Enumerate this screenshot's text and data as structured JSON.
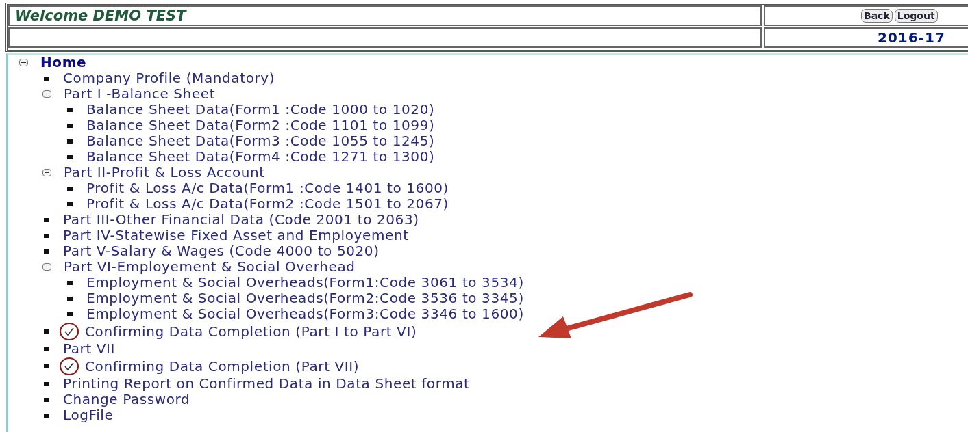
{
  "header": {
    "welcome": "Welcome DEMO TEST",
    "buttons": [
      "Back",
      "Logout"
    ],
    "year": "2016-17"
  },
  "tree": {
    "label": "Home",
    "expanded": true,
    "children": [
      {
        "label": "Company Profile (Mandatory)"
      },
      {
        "label": "Part I -Balance Sheet",
        "expanded": true,
        "children": [
          {
            "label": "Balance Sheet Data(Form1 :Code 1000 to 1020)"
          },
          {
            "label": "Balance Sheet Data(Form2 :Code 1101 to 1099)"
          },
          {
            "label": "Balance Sheet Data(Form3 :Code 1055 to 1245)"
          },
          {
            "label": "Balance Sheet Data(Form4 :Code 1271 to 1300)"
          }
        ]
      },
      {
        "label": "Part II-Profit & Loss Account",
        "expanded": true,
        "children": [
          {
            "label": "Profit & Loss A/c Data(Form1 :Code 1401 to 1600)"
          },
          {
            "label": "Profit & Loss A/c Data(Form2 :Code 1501 to 2067)"
          }
        ]
      },
      {
        "label": "Part III-Other Financial Data (Code 2001 to 2063)"
      },
      {
        "label": "Part IV-Statewise Fixed Asset and Employement"
      },
      {
        "label": "Part V-Salary & Wages (Code 4000 to 5020)"
      },
      {
        "label": "Part VI-Employement & Social Overhead",
        "expanded": true,
        "children": [
          {
            "label": "Employment & Social Overheads(Form1:Code 3061 to 3534)"
          },
          {
            "label": "Employment & Social Overheads(Form2:Code 3536 to 3345)"
          },
          {
            "label": "Employment & Social Overheads(Form3:Code 3346 to 1600)"
          }
        ]
      },
      {
        "label": "Confirming Data Completion (Part I to Part VI)",
        "kind": "confirm"
      },
      {
        "label": "Part VII"
      },
      {
        "label": "Confirming Data Completion (Part VII)",
        "kind": "confirm"
      },
      {
        "label": "Printing Report on Confirmed Data in Data Sheet format"
      },
      {
        "label": "Change Password"
      },
      {
        "label": "LogFile"
      }
    ]
  },
  "annotation_arrow": true
}
